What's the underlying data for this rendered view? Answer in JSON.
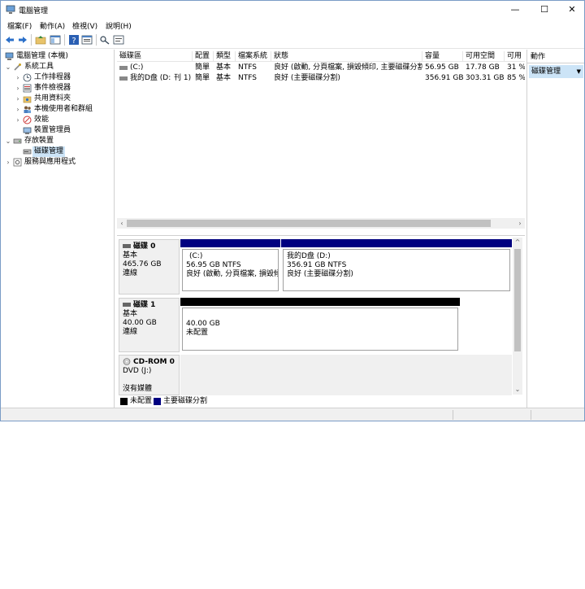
{
  "window": {
    "title": "電腦管理",
    "minimize": "—",
    "maximize": "☐",
    "close": "✕"
  },
  "menu": [
    "檔案(F)",
    "動作(A)",
    "檢視(V)",
    "說明(H)"
  ],
  "toolbar": [
    "back-arrow-icon",
    "forward-arrow-icon",
    "folder-up-icon",
    "show-hide-tree-icon",
    "help-icon",
    "properties-icon",
    "connect-icon",
    "console-icon"
  ],
  "tree": {
    "root": "電腦管理 (本機)",
    "system_tools": "系統工具",
    "task_scheduler": "工作排程器",
    "event_viewer": "事件檢視器",
    "shared_folders": "共用資料夾",
    "local_users": "本機使用者和群組",
    "performance": "效能",
    "device_manager": "裝置管理員",
    "storage": "存放裝置",
    "disk_management": "磁碟管理",
    "services": "服務與應用程式"
  },
  "volumes": {
    "headers": [
      "磁碟區",
      "配置",
      "類型",
      "檔案系統",
      "狀態",
      "容量",
      "可用空間",
      "可用"
    ],
    "rows": [
      [
        "(C:)",
        "簡單",
        "基本",
        "NTFS",
        "良好 (啟動, 分頁檔案, 損毀傾印, 主要磁碟分割)",
        "56.95 GB",
        "17.78 GB",
        "31 %"
      ],
      [
        "我的D盘 (D:)",
        "簡單",
        "基本",
        "NTFS",
        "良好 (主要磁碟分割)",
        "356.91 GB",
        "303.31 GB",
        "85 %"
      ]
    ],
    "row1_overflow": "刊 1)"
  },
  "disks": {
    "disk0": {
      "name": "磁碟 0",
      "type": "基本",
      "size": "465.76 GB",
      "status": "連線",
      "part1": {
        "label": "(C:)",
        "size": "56.95 GB NTFS",
        "status": "良好 (啟動, 分頁檔案, 損毀傾"
      },
      "part2": {
        "label": "我的D盘  (D:)",
        "size": "356.91 GB NTFS",
        "status": "良好 (主要磁碟分割)"
      }
    },
    "disk1": {
      "name": "磁碟 1",
      "type": "基本",
      "size": "40.00 GB",
      "status": "連線",
      "part1": {
        "size": "40.00 GB",
        "status": "未配置"
      }
    },
    "cdrom": {
      "name": "CD-ROM 0",
      "type": "DVD (J:)",
      "status": "沒有媒體"
    }
  },
  "legend": {
    "unallocated": "未配置",
    "primary": "主要磁碟分割"
  },
  "actions": {
    "header": "動作",
    "item": "磁碟管理"
  },
  "colors": {
    "primary": "#000080",
    "unallocated": "#000000",
    "selection": "#cce4f7"
  }
}
